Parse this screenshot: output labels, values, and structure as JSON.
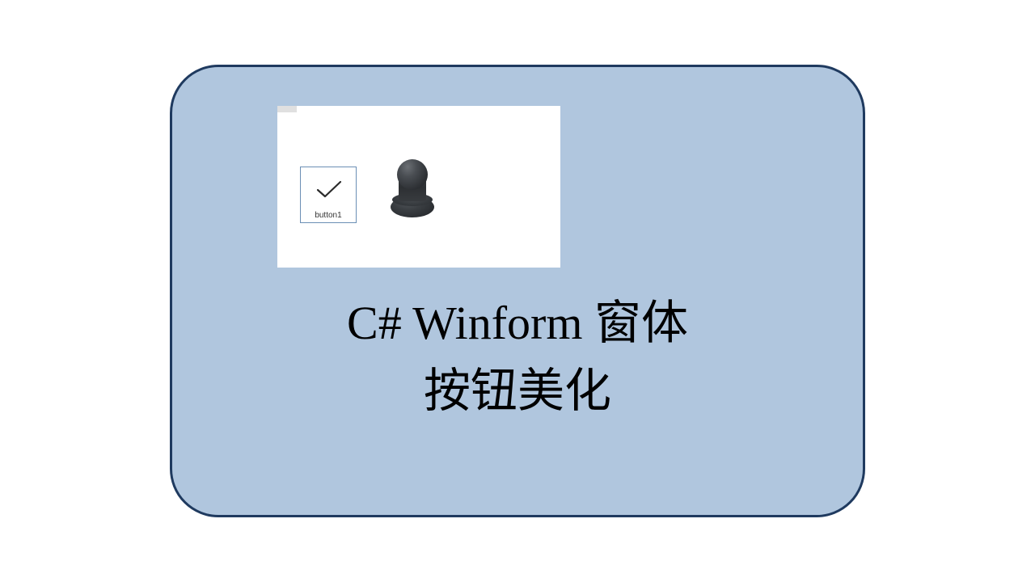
{
  "card": {
    "title_line1": "C# Winform 窗体",
    "title_line2": "按钮美化",
    "inner_screenshot": {
      "button_label": "button1"
    }
  }
}
